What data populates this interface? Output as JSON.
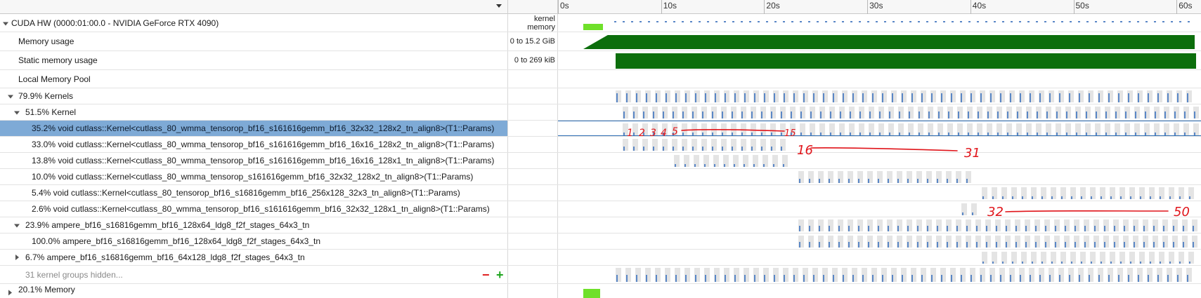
{
  "timeline": {
    "ticks": [
      {
        "label": "0s",
        "t": 0
      },
      {
        "label": "10s",
        "t": 10
      },
      {
        "label": "20s",
        "t": 20
      },
      {
        "label": "30s",
        "t": 30
      },
      {
        "label": "40s",
        "t": 40
      },
      {
        "label": "50s",
        "t": 50
      },
      {
        "label": "60s",
        "t": 60
      }
    ]
  },
  "device": {
    "label": "CUDA HW (0000:01:00.0 - NVIDIA GeForce RTX 4090)",
    "legend_line1": "kernel",
    "legend_line2": "memory"
  },
  "rows": {
    "memory_usage": {
      "label": "Memory usage",
      "range": "0 to 15.2 GiB"
    },
    "static_memory": {
      "label": "Static memory usage",
      "range": "0 to 269 kiB"
    },
    "local_pool": {
      "label": "Local Memory Pool"
    },
    "kernels_group": {
      "label": "79.9% Kernels"
    },
    "kernel_sub": {
      "label": "51.5% Kernel"
    },
    "k1": {
      "label": "35.2% void cutlass::Kernel<cutlass_80_wmma_tensorop_bf16_s161616gemm_bf16_32x32_128x2_tn_align8>(T1::Params)"
    },
    "k2": {
      "label": "33.0% void cutlass::Kernel<cutlass_80_wmma_tensorop_bf16_s161616gemm_bf16_16x16_128x2_tn_align8>(T1::Params)"
    },
    "k3": {
      "label": "13.8% void cutlass::Kernel<cutlass_80_wmma_tensorop_bf16_s161616gemm_bf16_16x16_128x1_tn_align8>(T1::Params)"
    },
    "k4": {
      "label": "10.0% void cutlass::Kernel<cutlass_80_wmma_tensorop_s161616gemm_bf16_32x32_128x2_tn_align8>(T1::Params)"
    },
    "k5": {
      "label": "5.4% void cutlass::Kernel<cutlass_80_tensorop_bf16_s16816gemm_bf16_256x128_32x3_tn_align8>(T1::Params)"
    },
    "k6": {
      "label": "2.6% void cutlass::Kernel<cutlass_80_wmma_tensorop_bf16_s161616gemm_bf16_32x32_128x1_tn_align8>(T1::Params)"
    },
    "ampere_group": {
      "label": "23.9% ampere_bf16_s16816gemm_bf16_128x64_ldg8_f2f_stages_64x3_tn"
    },
    "ampere_sub": {
      "label": "100.0% ampere_bf16_s16816gemm_bf16_128x64_ldg8_f2f_stages_64x3_tn"
    },
    "ampere_other": {
      "label": "6.7% ampere_bf16_s16816gemm_bf16_64x128_ldg8_f2f_stages_64x3_tn"
    },
    "hidden": {
      "label": "31 kernel groups hidden...",
      "minus": "−",
      "plus": "+"
    },
    "memory_group": {
      "label": "20.1% Memory"
    }
  },
  "annotations": {
    "seq_a": [
      "1",
      "2",
      "3",
      "4",
      "5"
    ],
    "end_a": "15",
    "start_b": "16",
    "end_b": "31",
    "start_c": "32",
    "end_c": "50"
  },
  "colors": {
    "selection": "#7eaad6",
    "kernel_mark": "#5a87c6",
    "memory_fill": "#0c6e0c",
    "legend_kernel": "#6fe02a",
    "annotation_ink": "#e0141a"
  }
}
